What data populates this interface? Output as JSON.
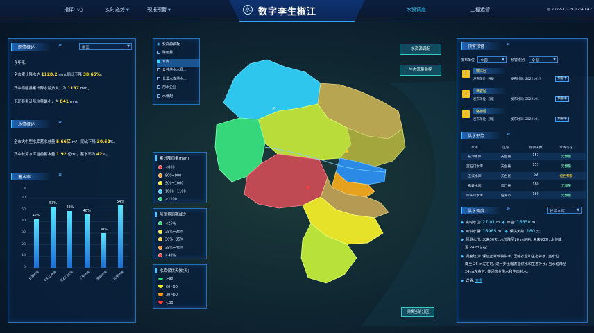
{
  "top": {
    "nav_left": [
      "指挥中心",
      "实时态势",
      "预报预警"
    ],
    "nav_right": [
      "水资调度",
      "工程运管"
    ],
    "title": "数字李生椒江",
    "title_logo": "水",
    "datetime": "2022-11-29 12:40:42"
  },
  "left": {
    "rain": {
      "title": "雨情概述",
      "select": "椒江",
      "year_line": "今年来,",
      "l1_pre": "全市累计降水达",
      "l1_v1": "1128.2",
      "l1_mid": "mm,同比下降",
      "l1_v2": "38.65%",
      "l1_post": "。",
      "l2_pre": "其中临区县累计降水最多大，为",
      "l2_v": "1197",
      "l2_post": "mm；",
      "l3_pre": "玉环县累计降水量最小，为",
      "l3_v": "841",
      "l3_post": "mm。"
    },
    "water": {
      "title": "水情概述",
      "l1_pre": "全市大中型水库蓄水总量",
      "l1_v1": "5.66亿",
      "l1_mid": "m³，同比下降",
      "l1_v2": "30.62",
      "l1_post": "%。",
      "l2_pre": "其中长潭水库当前蓄水量",
      "l2_v1": "1.92",
      "l2_mid": "亿m³，蓄水率为",
      "l2_v2": "42",
      "l2_post": "%。"
    },
    "reservoir_chart_title": "蓄水率"
  },
  "chart_data": {
    "type": "bar",
    "title": "蓄水率",
    "ylabel": "%",
    "ylim": [
      0,
      60
    ],
    "yticks": [
      0,
      10,
      20,
      30,
      40,
      50,
      60
    ],
    "categories": [
      "长潭水库",
      "牛头山水库",
      "里石门水库",
      "下岸水库",
      "佛岭水库",
      "北岸水库"
    ],
    "values": [
      42,
      53,
      49,
      46,
      30,
      54
    ],
    "labels": [
      "42%",
      "53%",
      "49%",
      "46%",
      "30%",
      "54%"
    ],
    "grid": true
  },
  "layers": {
    "title": "水资源调配",
    "items": [
      {
        "label": "降雨量",
        "on": false
      },
      {
        "label": "水库",
        "on": true
      },
      {
        "label": "公共供水水源...",
        "on": false
      },
      {
        "label": "长潭水库供水...",
        "on": false
      },
      {
        "label": "用水企业",
        "on": false
      },
      {
        "label": "水低配",
        "on": false
      }
    ]
  },
  "legends": {
    "rain": {
      "title": "累计降雨量(mm)",
      "items": [
        {
          "label": "<800",
          "color": "#ff3b3b"
        },
        {
          "label": "800~900",
          "color": "#ff9a1e"
        },
        {
          "label": "900~1000",
          "color": "#f5ee2a"
        },
        {
          "label": "1000~1100",
          "color": "#33c6ff"
        },
        {
          "label": ">1100",
          "color": "#2fe07b"
        }
      ]
    },
    "drop": {
      "title": "降雨量同期减少",
      "items": [
        {
          "label": "<25%",
          "color": "#2fe07b"
        },
        {
          "label": "25%~30%",
          "color": "#f5ee2a"
        },
        {
          "label": "30%~35%",
          "color": "#ffcc1e"
        },
        {
          "label": "35%~40%",
          "color": "#ff8a1e"
        },
        {
          "label": ">40%",
          "color": "#ff3b3b"
        }
      ]
    },
    "supply": {
      "title": "水库保供天数(天)",
      "items": [
        {
          "label": ">90",
          "color": "#2fe07b"
        },
        {
          "label": "60~90",
          "color": "#f5ee2a"
        },
        {
          "label": "30~60",
          "color": "#ff9a1e"
        },
        {
          "label": "<30",
          "color": "#ff3b3b"
        }
      ]
    }
  },
  "map_buttons": {
    "top1": "水资源调配",
    "top2": "生态流量监控",
    "bottom": "切换当前分区"
  },
  "right": {
    "warning": {
      "title": "预警预警",
      "unit_label": "发布单位",
      "unit_select": "全部",
      "level_label": "预警级别",
      "level_select": "全部",
      "items": [
        {
          "title": "椒江区",
          "pub": "发布单位: 县级",
          "time": "发布时间: 2022101?",
          "btn": "预警中"
        },
        {
          "title": "黄岩区",
          "pub": "发布单位: 县级",
          "time": "发布时间: 2022101",
          "btn": "预警中"
        },
        {
          "title": "路桥区",
          "pub": "发布单位: 县级",
          "time": "发布时间: 2022101",
          "btn": "预警中"
        }
      ]
    },
    "supply": {
      "title": "供水形势",
      "headers": [
        "水库",
        "区域",
        "保供天数",
        "水库等级"
      ],
      "rows": [
        {
          "cells": [
            "长潭水库",
            "天台县",
            "157",
            "无预警"
          ],
          "status": "ok"
        },
        {
          "cells": [
            "里石门水库",
            "天台县",
            "157",
            "无预警"
          ],
          "status": "ok"
        },
        {
          "cells": [
            "五溪水库",
            "天台县",
            "59",
            "橙色预警"
          ],
          "status": "warn"
        },
        {
          "cells": [
            "佛岭水库",
            "三门县",
            "180",
            "无预警"
          ],
          "status": "ok"
        },
        {
          "cells": [
            "牛头山水库",
            "临海市",
            "180",
            "无预警"
          ],
          "status": "ok"
        }
      ]
    },
    "dispatch": {
      "title": "供水调度",
      "select": "长潭水库",
      "cap_label": "实时水位:",
      "cap_val": "27.01",
      "cap_unit": "m",
      "vol_label": "库容:",
      "vol_val": "16650",
      "vol_unit": "m³",
      "inflow_label": "可供水量:",
      "inflow_val": "16985",
      "inflow_unit": "m³",
      "days_label": "保供天数:",
      "days_val": "180",
      "days_unit": "天",
      "forecast_lines": [
        "预测水位: 未来30天, 水位降至26 m左右; 未来90天, 水位降",
        "至 24 m左右;"
      ],
      "advice_lines": [
        "调度建议: 保证正常城镇供水, 压缩农业和生态补水, 当水位",
        "降至 26 m左右时, 进一步压缩农业供水和生态补水; 当水位降至",
        "24 m左右时, 关闭农业供水和生态补水。"
      ],
      "detail_label": "详情:",
      "detail_link": "查看"
    }
  }
}
